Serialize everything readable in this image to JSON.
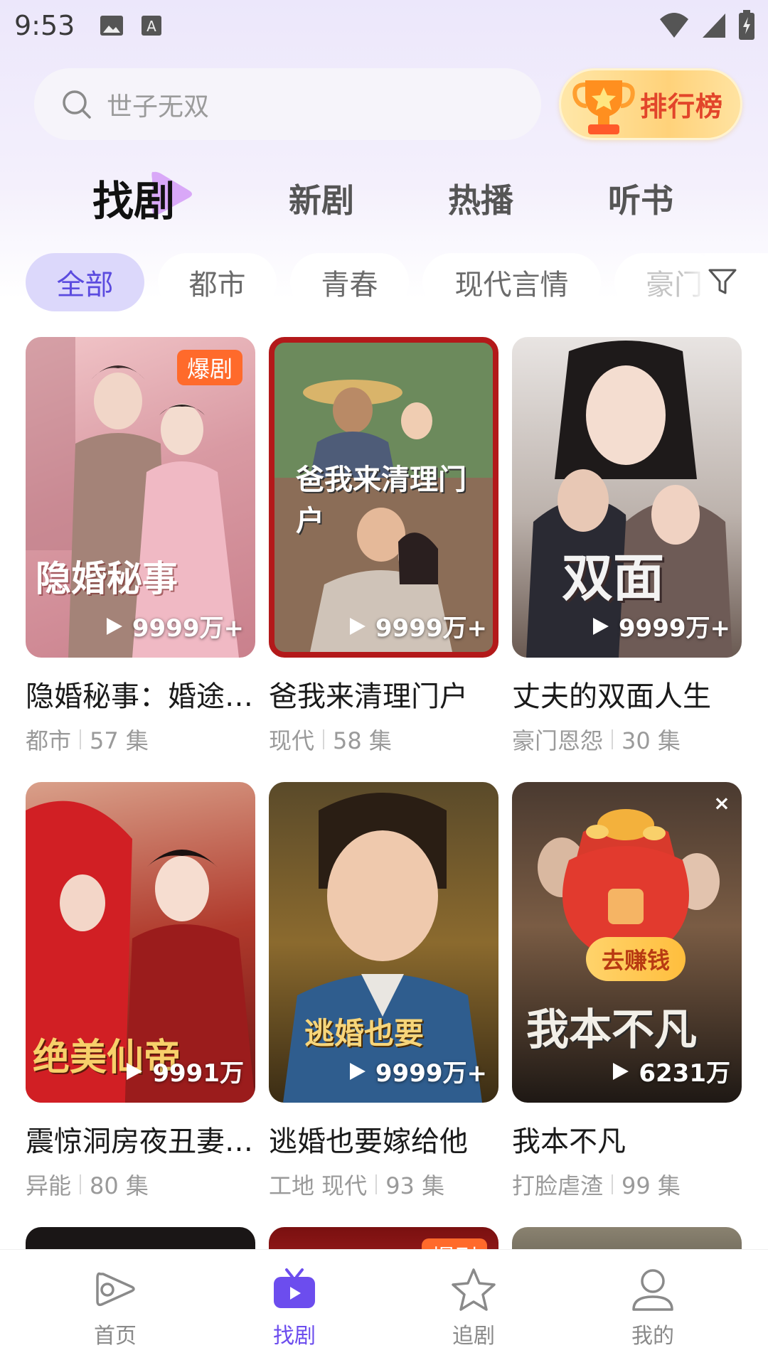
{
  "status_bar": {
    "time": "9:53"
  },
  "search": {
    "placeholder": "世子无双"
  },
  "rank_button": {
    "label": "排行榜"
  },
  "top_tabs": [
    {
      "label": "找剧",
      "active": true
    },
    {
      "label": "新剧",
      "active": false
    },
    {
      "label": "热播",
      "active": false
    },
    {
      "label": "听书",
      "active": false
    }
  ],
  "categories": [
    {
      "label": "全部",
      "active": true
    },
    {
      "label": "都市",
      "active": false
    },
    {
      "label": "青春",
      "active": false
    },
    {
      "label": "现代言情",
      "active": false
    },
    {
      "label": "豪门",
      "active": false
    }
  ],
  "dramas": [
    {
      "title": "隐婚秘事：婚途猎豪门",
      "poster_text": "隐婚秘事",
      "badge": "爆剧",
      "plays": "9999万+",
      "tags": "都市",
      "episodes": "57 集"
    },
    {
      "title": "爸我来清理门户",
      "poster_text": "爸我来清理门户",
      "plays": "9999万+",
      "tags": "现代",
      "episodes": "58 集"
    },
    {
      "title": "丈夫的双面人生",
      "poster_text": "双面",
      "plays": "9999万+",
      "tags": "豪门恩怨",
      "episodes": "30 集"
    },
    {
      "title": "震惊洞房夜丑妻变绝美仙帝",
      "poster_text": "绝美仙帝",
      "plays": "9991万",
      "tags": "异能",
      "episodes": "80 集"
    },
    {
      "title": "逃婚也要嫁给他",
      "poster_text": "逃婚也要",
      "plays": "9999万+",
      "tags": "工地 现代",
      "episodes": "93 集"
    },
    {
      "title": "我本不凡",
      "poster_text": "我本不凡",
      "plays": "6231万",
      "tags": "打脸虐渣",
      "episodes": "99 集",
      "earn": "去赚钱"
    }
  ],
  "peek_badge": "爆剧",
  "bottom_nav": [
    {
      "label": "首页",
      "icon": "home-icon",
      "active": false
    },
    {
      "label": "找剧",
      "icon": "tv-icon",
      "active": true
    },
    {
      "label": "追剧",
      "icon": "star-icon",
      "active": false
    },
    {
      "label": "我的",
      "icon": "profile-icon",
      "active": false
    }
  ],
  "colors": {
    "accent": "#6c4dee",
    "chip_active_bg": "#dcd8fb",
    "badge": "#ff6a2b"
  }
}
